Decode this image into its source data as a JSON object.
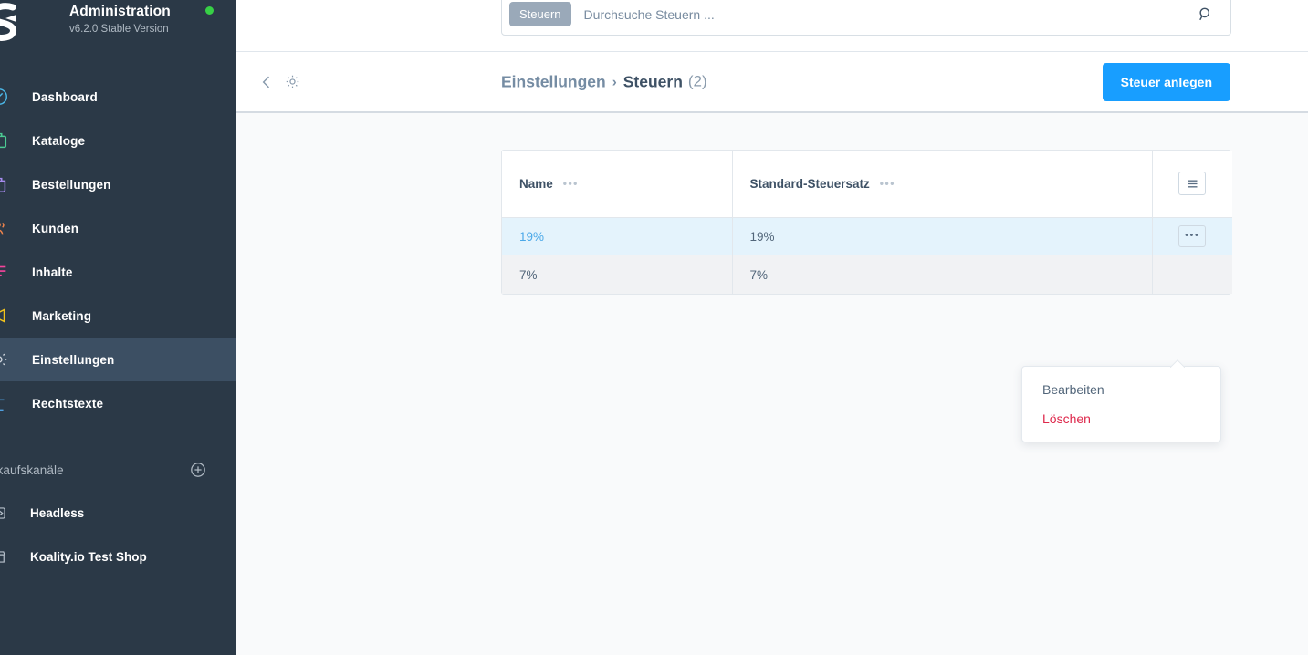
{
  "app": {
    "brand_title": "Administration",
    "version": "v6.2.0 Stable Version",
    "status_dot_color": "#37d046",
    "logo_icon": "shopware-logo-icon"
  },
  "sidebar": {
    "items": [
      {
        "label": "Dashboard",
        "icon": "dashboard-speedometer-icon",
        "color": "#4bb8e8",
        "active": false
      },
      {
        "label": "Kataloge",
        "icon": "catalog-box-icon",
        "color": "#4ccb94",
        "active": false
      },
      {
        "label": "Bestellungen",
        "icon": "orders-bag-icon",
        "color": "#a78cf0",
        "active": false
      },
      {
        "label": "Kunden",
        "icon": "customers-people-icon",
        "color": "#f0844c",
        "active": false
      },
      {
        "label": "Inhalte",
        "icon": "content-lines-icon",
        "color": "#f5449b",
        "active": false
      },
      {
        "label": "Marketing",
        "icon": "marketing-megaphone-icon",
        "color": "#f2c31c",
        "active": false
      },
      {
        "label": "Einstellungen",
        "icon": "settings-gear-icon",
        "color": "#cfd6de",
        "active": true
      },
      {
        "label": "Rechtstexte",
        "icon": "legal-scales-icon",
        "color": "#4f9fe0",
        "active": false
      }
    ],
    "section": {
      "label": "Verkaufskanäle",
      "add_icon": "plus-circle-icon"
    },
    "channels": [
      {
        "label": "Headless",
        "icon": "headless-channel-icon"
      },
      {
        "label": "Koality.io Test Shop",
        "icon": "storefront-channel-icon"
      }
    ]
  },
  "search": {
    "scope_pill": "Steuern",
    "placeholder": "Durchsuche Steuern ...",
    "value": "",
    "icon": "search-magnifier-icon"
  },
  "header": {
    "back_icon": "chevron-left-icon",
    "gear_icon": "gear-icon",
    "breadcrumb_parent": "Einstellungen",
    "breadcrumb_separator": "›",
    "breadcrumb_current": "Steuern",
    "breadcrumb_count": "(2)",
    "primary_button": "Steuer anlegen",
    "primary_button_color": "#189eff"
  },
  "table": {
    "columns": [
      {
        "label": "Name",
        "menu_icon": "column-options-dots-icon"
      },
      {
        "label": "Standard-Steuersatz",
        "menu_icon": "column-options-dots-icon"
      }
    ],
    "settings_icon": "table-settings-hamburger-icon",
    "row_action_icon": "row-actions-dots-icon",
    "rows": [
      {
        "name": "19%",
        "rate": "19%",
        "selected": true
      },
      {
        "name": "7%",
        "rate": "7%",
        "selected": false
      }
    ]
  },
  "context_menu": {
    "items": [
      {
        "label": "Bearbeiten",
        "danger": false
      },
      {
        "label": "Löschen",
        "danger": true
      }
    ],
    "danger_color": "#de294c"
  }
}
